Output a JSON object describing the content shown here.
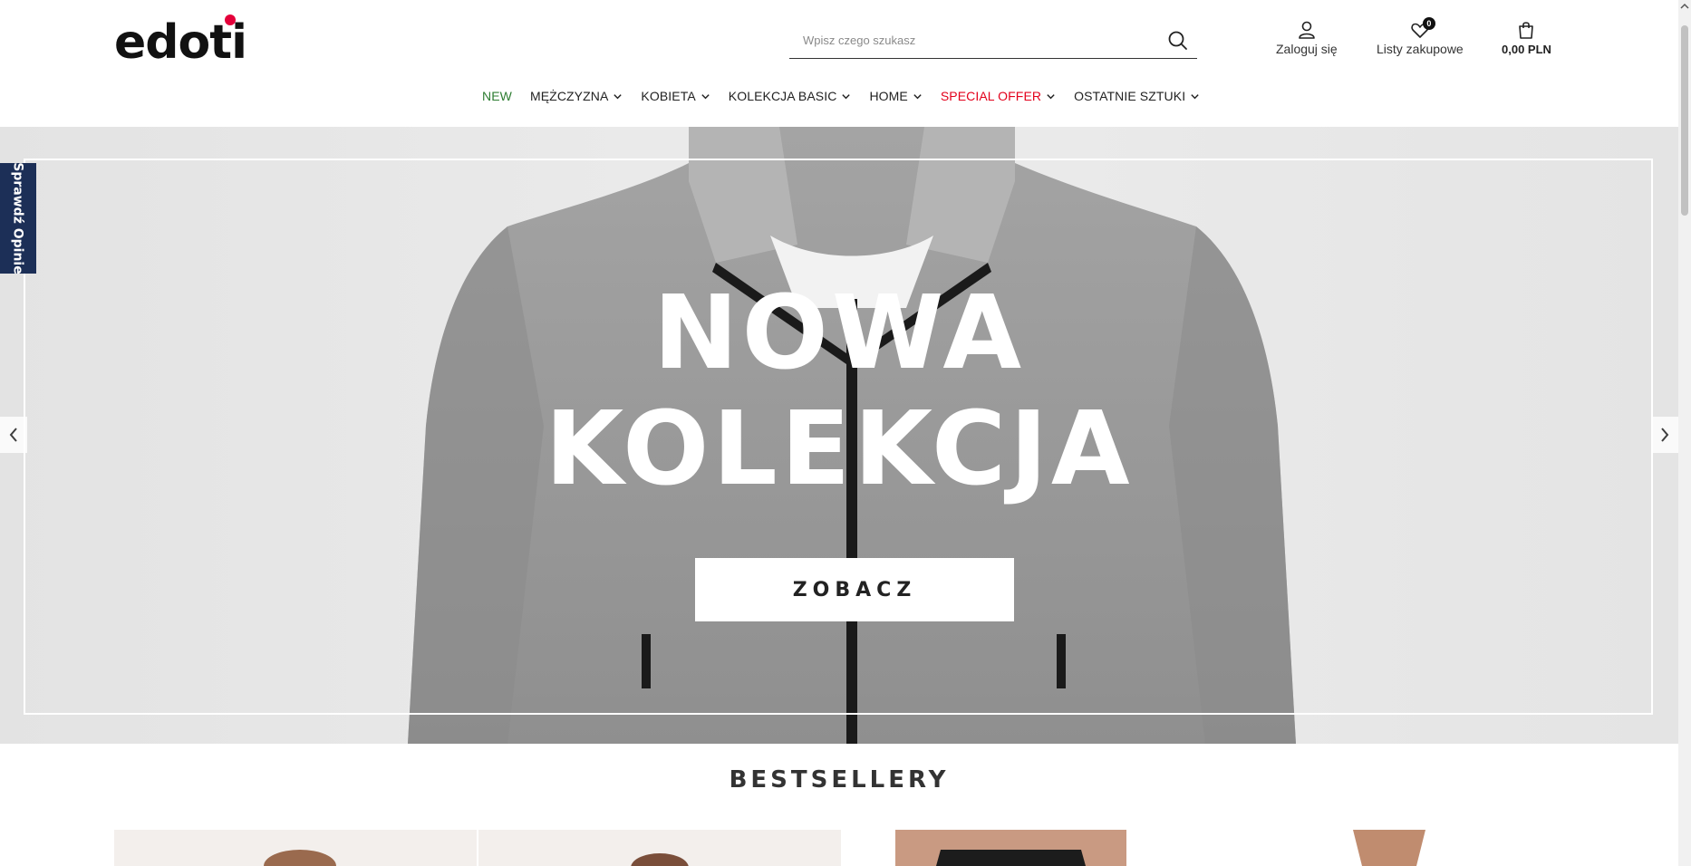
{
  "brand": {
    "logo_text": "edoti",
    "accent": "#e4003a"
  },
  "search": {
    "placeholder": "Wpisz czego szukasz"
  },
  "header": {
    "login_label": "Zaloguj się",
    "wishlist_label": "Listy zakupowe",
    "wishlist_count": "0",
    "cart_total": "0,00 PLN"
  },
  "nav": {
    "items": [
      {
        "label": "NEW",
        "color": "#2e7d32",
        "dropdown": false
      },
      {
        "label": "MĘŻCZYZNA",
        "color": "#222222",
        "dropdown": true
      },
      {
        "label": "KOBIETA",
        "color": "#222222",
        "dropdown": true
      },
      {
        "label": "KOLEKCJA BASIC",
        "color": "#222222",
        "dropdown": true
      },
      {
        "label": "HOME",
        "color": "#222222",
        "dropdown": true
      },
      {
        "label": "SPECIAL OFFER",
        "color": "#e3001b",
        "dropdown": true
      },
      {
        "label": "OSTATNIE SZTUKI",
        "color": "#222222",
        "dropdown": true
      }
    ]
  },
  "hero": {
    "line1": "NOWA",
    "line2": "KOLEKCJA",
    "cta": "ZOBACZ"
  },
  "reviews_tab": {
    "label": "Sprawdź Opinie",
    "color": "#1c2f57"
  },
  "bestsellers": {
    "title": "BESTSELLERY"
  }
}
